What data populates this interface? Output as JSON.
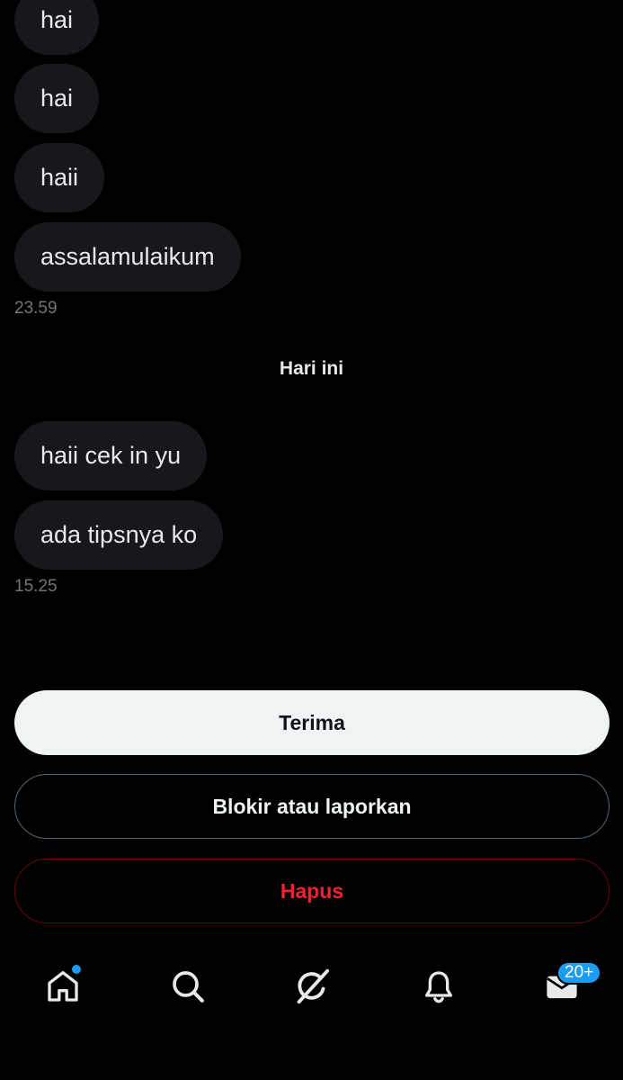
{
  "conversation": {
    "earlier_messages": [
      {
        "text": "hai"
      },
      {
        "text": "hai"
      },
      {
        "text": "haii"
      },
      {
        "text": "assalamulaikum"
      }
    ],
    "earlier_timestamp": "23.59",
    "day_divider": "Hari ini",
    "today_messages": [
      {
        "text": "haii cek in yu"
      },
      {
        "text": "ada tipsnya ko"
      }
    ],
    "today_timestamp": "15.25"
  },
  "actions": {
    "accept_label": "Terima",
    "block_report_label": "Blokir atau laporkan",
    "delete_label": "Hapus"
  },
  "bottom_nav": {
    "items": [
      {
        "icon": "home-icon",
        "has_dot": true
      },
      {
        "icon": "search-icon"
      },
      {
        "icon": "grok-icon"
      },
      {
        "icon": "bell-icon"
      },
      {
        "icon": "envelope-icon",
        "badge": "20+"
      }
    ]
  },
  "colors": {
    "background": "#000000",
    "bubble": "#16181c",
    "primary_button": "#eff3f4",
    "danger": "#f4212e",
    "accent": "#1d9bf0"
  }
}
